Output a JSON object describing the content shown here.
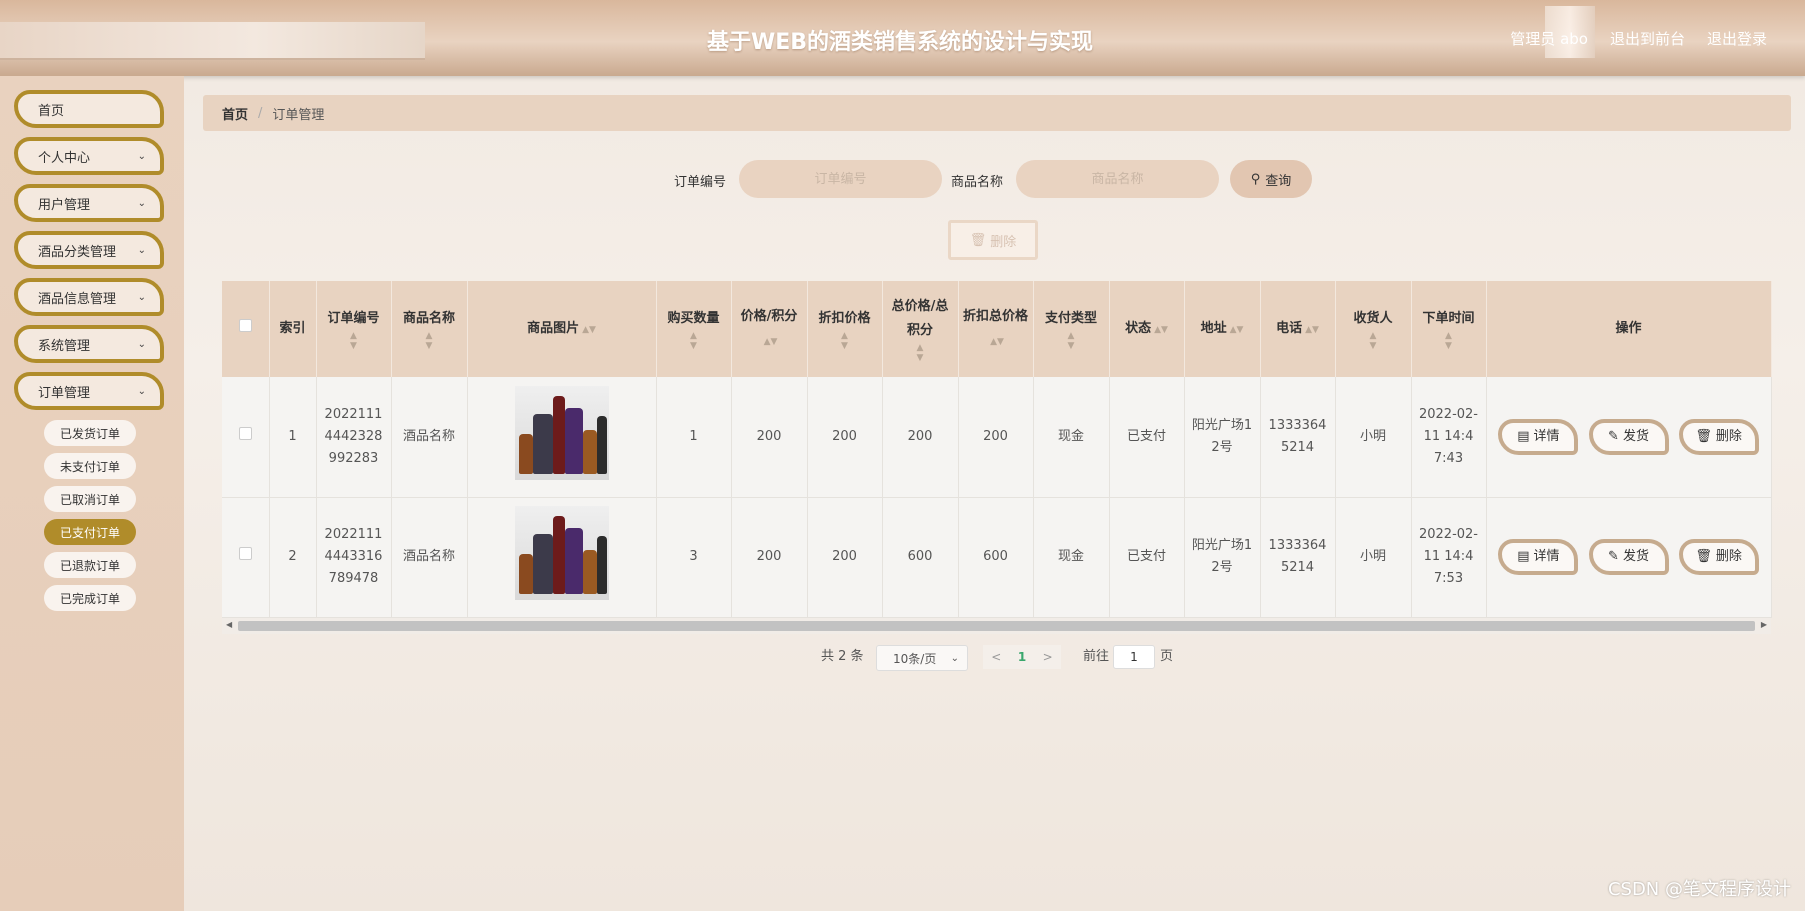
{
  "header": {
    "title": "基于WEB的酒类销售系统的设计与实现",
    "admin_label": "管理员 abo",
    "front_link": "退出到前台",
    "logout_link": "退出登录"
  },
  "sidebar": {
    "items": [
      {
        "label": "首页"
      },
      {
        "label": "个人中心"
      },
      {
        "label": "用户管理"
      },
      {
        "label": "酒品分类管理"
      },
      {
        "label": "酒品信息管理"
      },
      {
        "label": "系统管理"
      },
      {
        "label": "订单管理"
      }
    ],
    "sub_items": [
      {
        "label": "已发货订单"
      },
      {
        "label": "未支付订单"
      },
      {
        "label": "已取消订单"
      },
      {
        "label": "已支付订单"
      },
      {
        "label": "已退款订单"
      },
      {
        "label": "已完成订单"
      }
    ]
  },
  "breadcrumb": {
    "home": "首页",
    "sep": "/",
    "current": "订单管理"
  },
  "search": {
    "order_no_label": "订单编号",
    "order_no_placeholder": "订单编号",
    "product_label": "商品名称",
    "product_placeholder": "商品名称",
    "query_label": "查询",
    "delete_label": "删除"
  },
  "table": {
    "headers": [
      "索引",
      "订单编号",
      "商品名称",
      "商品图片",
      "购买数量",
      "价格/积分",
      "折扣价格",
      "总价格/总积分",
      "折扣总价格",
      "支付类型",
      "状态",
      "地址",
      "电话",
      "收货人",
      "下单时间",
      "操作"
    ],
    "rows": [
      {
        "index": "1",
        "order_no": "20221114442328992283",
        "product": "酒品名称",
        "qty": "1",
        "price": "200",
        "discount_price": "200",
        "total": "200",
        "discount_total": "200",
        "pay_type": "现金",
        "status": "已支付",
        "address": "阳光广场12号",
        "phone": "13333645214",
        "receiver": "小明",
        "time": "2022-02-11 14:47:43"
      },
      {
        "index": "2",
        "order_no": "20221114443316789478",
        "product": "酒品名称",
        "qty": "3",
        "price": "200",
        "discount_price": "200",
        "total": "600",
        "discount_total": "600",
        "pay_type": "现金",
        "status": "已支付",
        "address": "阳光广场12号",
        "phone": "13333645214",
        "receiver": "小明",
        "time": "2022-02-11 14:47:53"
      }
    ],
    "actions": {
      "detail": "详情",
      "ship": "发货",
      "delete": "删除"
    }
  },
  "pagination": {
    "total": "共 2 条",
    "page_size": "10条/页",
    "current_page": "1",
    "goto_label": "前往",
    "goto_value": "1",
    "page_unit": "页"
  },
  "watermark": "CSDN @笔文程序设计"
}
